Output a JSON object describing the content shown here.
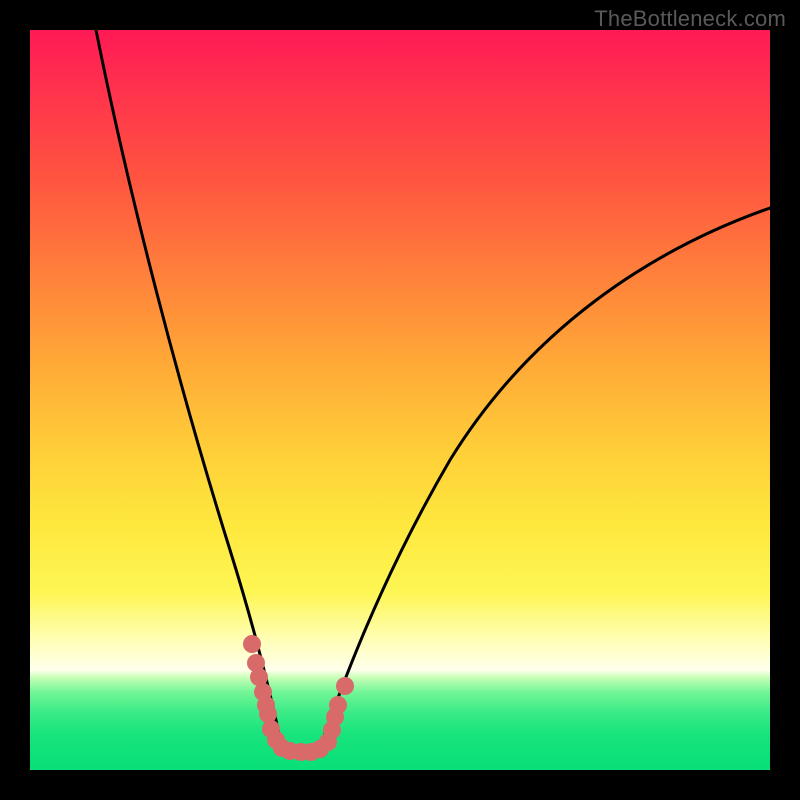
{
  "watermark": "TheBottleneck.com",
  "chart_data": {
    "type": "line",
    "title": "",
    "xlabel": "",
    "ylabel": "",
    "xlim": [
      0,
      100
    ],
    "ylim": [
      0,
      100
    ],
    "note": "Stylized bottleneck curve. x loosely = component balance; y loosely = bottleneck %. Background gradient: red (high bottleneck) → green (none). Two black curves descend into a V; a cluster of coral dots sits around the minimum.",
    "series": [
      {
        "name": "left-curve",
        "x": [
          9,
          12,
          15,
          18,
          21,
          24,
          27,
          29,
          31,
          33,
          34.5
        ],
        "y": [
          100,
          82,
          66,
          52,
          40,
          30,
          21,
          14,
          9,
          5,
          2.5
        ]
      },
      {
        "name": "right-curve",
        "x": [
          39,
          41,
          44,
          48,
          53,
          59,
          66,
          74,
          83,
          92,
          100
        ],
        "y": [
          2.5,
          5,
          10,
          18,
          28,
          39,
          50,
          59,
          66,
          72,
          76
        ]
      }
    ],
    "scatter": {
      "name": "sample-points",
      "color": "#d86a6a",
      "points": [
        {
          "x": 30.0,
          "y": 17.0
        },
        {
          "x": 30.6,
          "y": 14.4
        },
        {
          "x": 31.0,
          "y": 12.6
        },
        {
          "x": 31.5,
          "y": 10.6
        },
        {
          "x": 31.9,
          "y": 8.8
        },
        {
          "x": 32.1,
          "y": 7.6
        },
        {
          "x": 32.6,
          "y": 5.6
        },
        {
          "x": 33.2,
          "y": 4.0
        },
        {
          "x": 34.0,
          "y": 3.0
        },
        {
          "x": 35.2,
          "y": 2.6
        },
        {
          "x": 36.6,
          "y": 2.4
        },
        {
          "x": 38.0,
          "y": 2.4
        },
        {
          "x": 39.2,
          "y": 2.8
        },
        {
          "x": 40.2,
          "y": 3.8
        },
        {
          "x": 40.8,
          "y": 5.4
        },
        {
          "x": 41.2,
          "y": 7.2
        },
        {
          "x": 41.6,
          "y": 8.8
        },
        {
          "x": 42.6,
          "y": 11.4
        }
      ]
    },
    "gradient_stops": [
      {
        "pct": 0,
        "color": "#ff1a55"
      },
      {
        "pct": 33,
        "color": "#ff803b"
      },
      {
        "pct": 67,
        "color": "#fee83e"
      },
      {
        "pct": 86,
        "color": "#ffffec"
      },
      {
        "pct": 100,
        "color": "#08df78"
      }
    ]
  }
}
